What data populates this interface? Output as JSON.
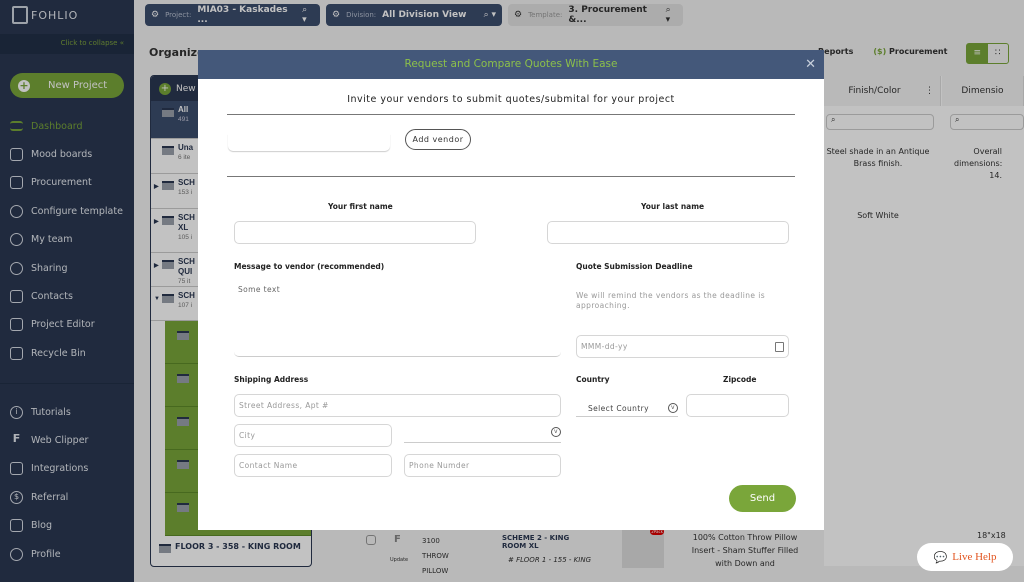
{
  "brand": "FOHLIO",
  "sidebar": {
    "collapse": "Click to collapse",
    "new_project": "New Project",
    "items": [
      {
        "label": "Dashboard",
        "icon": "menu-icon"
      },
      {
        "label": "Mood boards",
        "icon": "moodboard-icon"
      },
      {
        "label": "Procurement",
        "icon": "document-icon"
      },
      {
        "label": "Configure template",
        "icon": "gear-icon"
      },
      {
        "label": "My team",
        "icon": "team-icon"
      },
      {
        "label": "Sharing",
        "icon": "share-icon"
      },
      {
        "label": "Contacts",
        "icon": "contacts-icon"
      },
      {
        "label": "Project Editor",
        "icon": "edit-icon"
      },
      {
        "label": "Recycle Bin",
        "icon": "trash-icon"
      }
    ],
    "bottom_items": [
      {
        "label": "Tutorials",
        "icon": "info-icon"
      },
      {
        "label": "Web Clipper",
        "icon": "web-clipper-icon"
      },
      {
        "label": "Integrations",
        "icon": "puzzle-icon"
      },
      {
        "label": "Referral",
        "icon": "dollar-icon"
      },
      {
        "label": "Blog",
        "icon": "rss-icon"
      },
      {
        "label": "Profile",
        "icon": "user-icon"
      }
    ]
  },
  "topbar": {
    "project_label": "Project:",
    "project_value": "MIA03 - Kaskades ...",
    "division_label": "Division:",
    "division_value": "All Division View",
    "template_label": "Template:",
    "template_value": "3. Procurement &..."
  },
  "page": {
    "organize": "Organize",
    "reports": "Reports",
    "procurement": "Procurement"
  },
  "tree": {
    "new": "New",
    "nodes": [
      {
        "title": "All",
        "sub": "491"
      },
      {
        "title": "Una",
        "sub": "6 ite"
      },
      {
        "title": "SCH",
        "sub": "153 i"
      },
      {
        "title": "SCH XL",
        "sub": "105 i"
      },
      {
        "title": "SCH QUI",
        "sub": "75 it"
      },
      {
        "title": "SCH",
        "sub": "107 i"
      }
    ],
    "last": "FLOOR 3 - 358 - KING ROOM"
  },
  "grid": {
    "headers": [
      "Finish/Color",
      "Dimensio"
    ],
    "cells": [
      "Steel shade in an Antique Brass finish.",
      "Overall dimensions: 14.",
      "Soft White"
    ],
    "bottom_row": {
      "name": "3100 THROW PILLOW",
      "update": "Update",
      "scheme": "SCHEME 2 - KING ROOM XL",
      "floor": "# FLOOR 1 - 155 - KING",
      "badge": "2Pack",
      "desc": "100% Cotton Throw Pillow Insert - Sham Stuffer Filled with Down and",
      "dim": "18\"x18"
    }
  },
  "modal": {
    "title": "Request and Compare Quotes With Ease",
    "subtitle": "Invite your vendors to submit quotes/submital for your project",
    "add_vendor": "Add vendor",
    "first_name": "Your first name",
    "last_name": "Your last name",
    "message_label": "Message to vendor (recommended)",
    "message_value": "Some text",
    "deadline_label": "Quote Submission Deadline",
    "deadline_note": "We will remind the vendors as the deadline is approaching.",
    "date_placeholder": "MMM-dd-yy",
    "shipping_label": "Shipping Address",
    "street_placeholder": "Street Address, Apt #",
    "city_placeholder": "City",
    "contact_placeholder": "Contact Name",
    "phone_placeholder": "Phone Numder",
    "country_label": "Country",
    "country_value": "Select Country",
    "zip_label": "Zipcode",
    "send": "Send"
  },
  "live_help": "Live Help",
  "colors": {
    "accent": "#7aa63a",
    "sidebar": "#2b3852",
    "modal_header": "#44587a",
    "live_help": "#e2541f"
  }
}
